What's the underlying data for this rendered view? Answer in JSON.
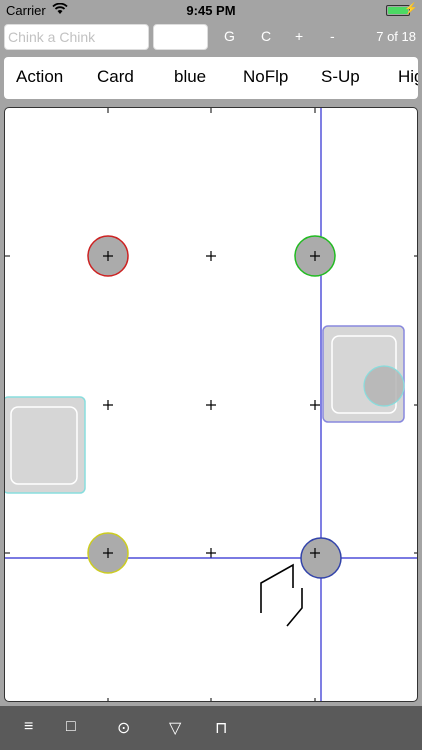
{
  "status": {
    "carrier": "Carrier",
    "time": "9:45 PM",
    "wifi_icon": "wifi-icon",
    "battery_icon": "battery-icon"
  },
  "toolbar": {
    "search_placeholder": "Chink a Chink",
    "second_field_value": "",
    "btn_g": "G",
    "btn_c": "C",
    "btn_plus": "+",
    "btn_minus": "-",
    "pager": "7 of 18"
  },
  "modes": [
    "Action",
    "Card",
    "blue",
    "NoFlp",
    "S-Up",
    "Hig"
  ],
  "bottom": {
    "icons": [
      "menu-icon",
      "square-icon",
      "circle-target-icon",
      "triangle-down-icon",
      "bracket-icon"
    ],
    "glyphs": [
      "≡",
      "□",
      "⊙",
      "▽",
      "⊓"
    ]
  },
  "board": {
    "tokens": [
      {
        "label": "+",
        "color": "#cc2222"
      },
      {
        "label": "+",
        "color": "#22bb22"
      },
      {
        "label": "+",
        "color": "#cccc22"
      },
      {
        "label": "+",
        "color": "#3344aa"
      }
    ],
    "guide_color": "#2a2ad0"
  }
}
